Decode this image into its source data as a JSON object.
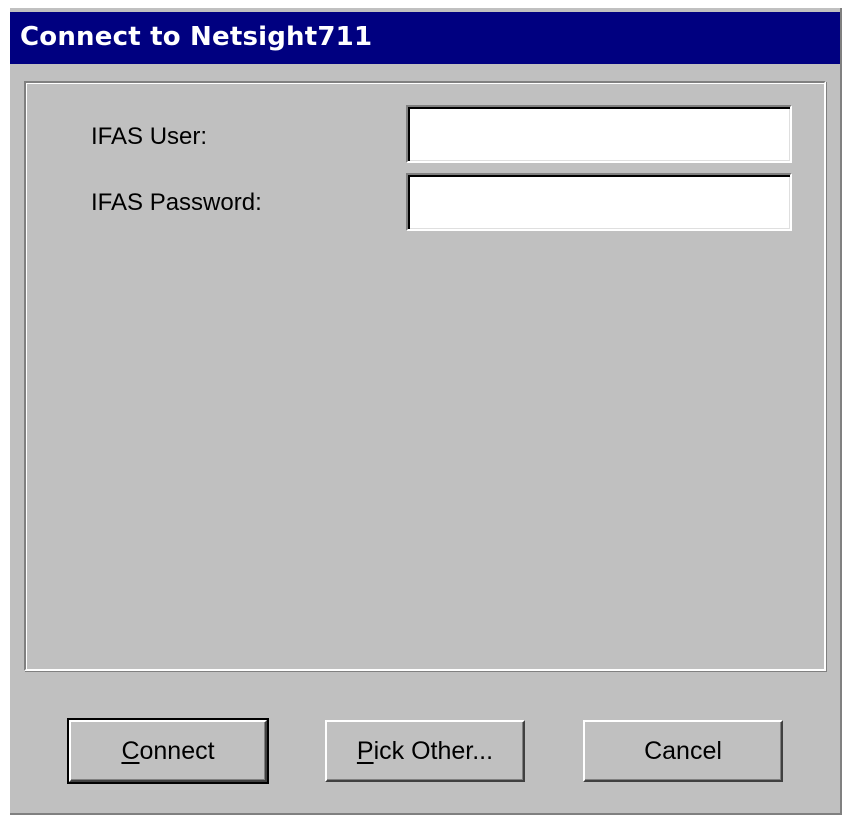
{
  "window": {
    "title": "Connect to Netsight711"
  },
  "form": {
    "user_label": "IFAS User:",
    "user_value": "",
    "password_label": "IFAS Password:",
    "password_value": ""
  },
  "buttons": {
    "connect": {
      "mnemonic": "C",
      "rest": "onnect"
    },
    "pick_other": {
      "mnemonic": "P",
      "rest": "ick Other..."
    },
    "cancel": {
      "label": "Cancel"
    }
  },
  "colors": {
    "titlebar": "#000080",
    "face": "#c0c0c0",
    "field": "#ffffff"
  }
}
